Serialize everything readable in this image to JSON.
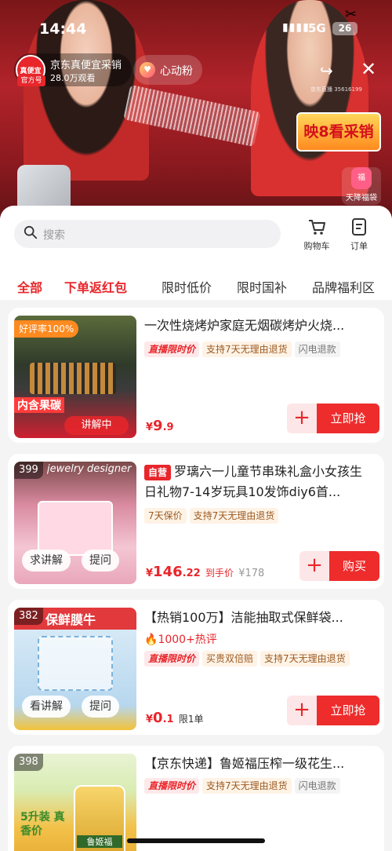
{
  "status_bar": {
    "time": "14:44",
    "network": "5G",
    "battery": "26"
  },
  "live": {
    "store_logo_text": "真便宜",
    "store_badge": "官方号",
    "store_name": "京东真便宜采销",
    "viewers": "28.0万观看",
    "follow_label": "心动粉",
    "live_id": "京东直播 35616199",
    "promo_text": "映8看采销",
    "lucky_bag_icon": "福",
    "lucky_bag_label": "天降福袋"
  },
  "search": {
    "placeholder": "搜索"
  },
  "nav": {
    "cart_label": "购物车",
    "orders_label": "订单"
  },
  "tabs": [
    "全部",
    "下单返红包",
    "限时低价",
    "限时国补",
    "品牌福利区"
  ],
  "products": [
    {
      "title": "一次性烧烤炉家庭无烟碳烤炉火烧...",
      "tags": [
        "直播限时价",
        "支持7天无理由退货",
        "闪电退款"
      ],
      "thumb_badge": "好评率100%",
      "thumb_bottom": "内含果碳",
      "thumb_status": "讲解中",
      "price_symbol": "¥",
      "price_int": "9",
      "price_dec": ".9",
      "buy_label": "立即抢"
    },
    {
      "rank": "399",
      "self_run_tag": "自营",
      "title": "罗璃六一儿童节串珠礼盒小女孩生日礼物7-14岁玩具10发饰diy6首...",
      "tags": [
        "7天保价",
        "支持7天无理由退货"
      ],
      "thumb_text": "jewelry designer",
      "explain_label": "求讲解",
      "ask_label": "提问",
      "price_symbol": "¥",
      "price_int": "146",
      "price_dec": ".22",
      "price_note": "到手价",
      "original_price": "¥178",
      "buy_label": "购买"
    },
    {
      "rank": "382",
      "title": "【热销100万】洁能抽取式保鲜袋...",
      "hot_review": "1000+热评",
      "tags": [
        "直播限时价",
        "买贵双倍赔",
        "支持7天无理由退货"
      ],
      "thumb_text": "保鲜膜牛",
      "explain_label": "看讲解",
      "ask_label": "提问",
      "price_symbol": "¥",
      "price_int": "0",
      "price_dec": ".1",
      "price_note": "限1单",
      "buy_label": "立即抢"
    },
    {
      "rank": "398",
      "title": "【京东快递】鲁姬福压榨一级花生...",
      "tags": [
        "直播限时价",
        "支持7天无理由退货",
        "闪电退款"
      ],
      "thumb_text": "5升装 真香价",
      "brand": "鲁姬福"
    }
  ],
  "colors": {
    "accent": "#e8262b",
    "live_bg": "#b2232a",
    "sheet_bg": "#f4f4f4"
  }
}
